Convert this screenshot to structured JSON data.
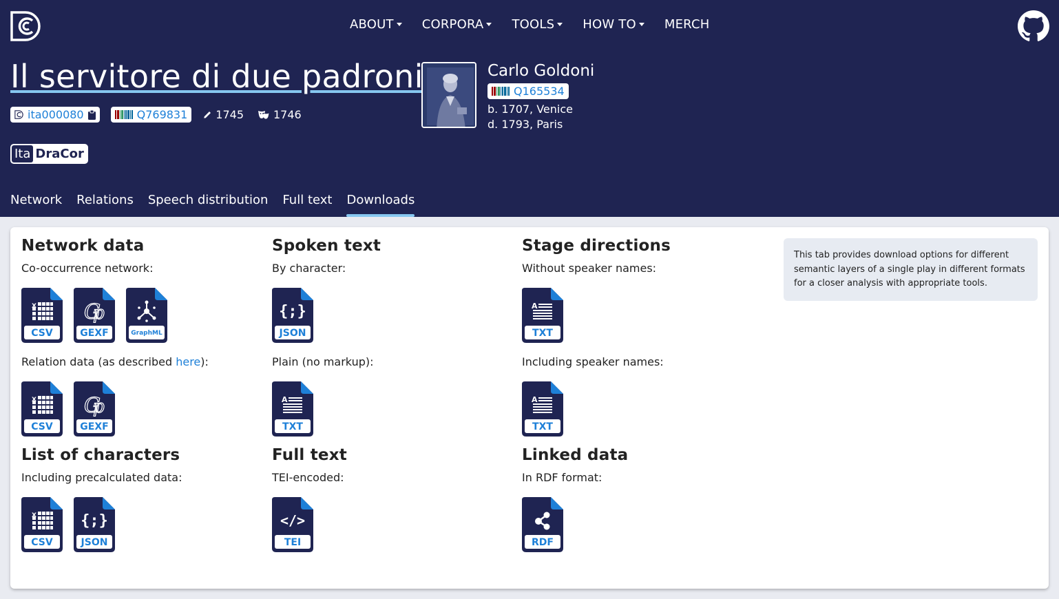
{
  "nav": {
    "items": [
      {
        "label": "ABOUT",
        "dropdown": true
      },
      {
        "label": "CORPORA",
        "dropdown": true
      },
      {
        "label": "TOOLS",
        "dropdown": true
      },
      {
        "label": "HOW TO",
        "dropdown": true
      },
      {
        "label": "MERCH",
        "dropdown": false
      }
    ]
  },
  "play": {
    "title": "Il servitore di due padroni",
    "dracor_id": "ita000080",
    "wikidata_id": "Q769831",
    "written_year": "1745",
    "premiere_year": "1746"
  },
  "corpus": {
    "prefix": "Ita",
    "name": "DraCor"
  },
  "author": {
    "name": "Carlo Goldoni",
    "wikidata_id": "Q165534",
    "born": "b. 1707, Venice",
    "died": "d. 1793, Paris"
  },
  "tabs": [
    "Network",
    "Relations",
    "Speech distribution",
    "Full text",
    "Downloads"
  ],
  "active_tab": "Downloads",
  "downloads": {
    "network": {
      "title": "Network data",
      "cooccurrence_label": "Co-occurrence network:",
      "cooccurrence_files": [
        "CSV",
        "GEXF",
        "GraphML"
      ],
      "relation_label_prefix": "Relation data (as described ",
      "relation_link": "here",
      "relation_label_suffix": "):",
      "relation_files": [
        "CSV",
        "GEXF"
      ]
    },
    "spoken": {
      "title": "Spoken text",
      "by_character_label": "By character:",
      "by_character_files": [
        "JSON"
      ],
      "plain_label": "Plain (no markup):",
      "plain_files": [
        "TXT"
      ]
    },
    "stage": {
      "title": "Stage directions",
      "without_label": "Without speaker names:",
      "without_files": [
        "TXT"
      ],
      "including_label": "Including speaker names:",
      "including_files": [
        "TXT"
      ]
    },
    "characters": {
      "title": "List of characters",
      "label": "Including precalculated data:",
      "files": [
        "CSV",
        "JSON"
      ]
    },
    "fulltext": {
      "title": "Full text",
      "label": "TEI-encoded:",
      "files": [
        "TEI"
      ]
    },
    "linked": {
      "title": "Linked data",
      "label": "In RDF format:",
      "files": [
        "RDF"
      ]
    }
  },
  "info_text": "This tab provides download options for different semantic layers of a single play in different formats for a closer analysis with appropriate tools.",
  "colors": {
    "header_bg": "#1f2452",
    "accent": "#1e80d8",
    "underline": "#86c7f0"
  }
}
